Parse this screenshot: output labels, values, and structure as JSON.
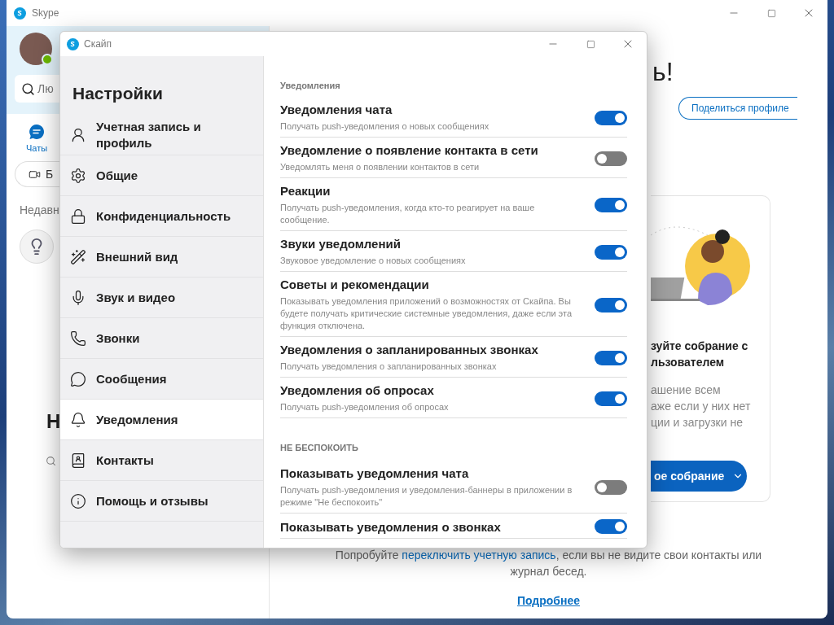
{
  "main_window": {
    "title": "Skype",
    "search": {
      "placeholder": "Лю"
    },
    "nav_tab": {
      "label": "Чаты",
      "selected": true
    },
    "meet_button": "Б",
    "recent_heading": "Недавн",
    "side_heading": "Н",
    "greeting": "ь!",
    "share_button": "Поделиться профиле",
    "card": {
      "title_lines": [
        "зуйте собрание с",
        "льзователем"
      ],
      "text_lines": [
        "ашение всем",
        "аже если у них нет",
        "ции и загрузки не"
      ],
      "button": "ое собрание"
    },
    "footer": {
      "before": "Попробуйте ",
      "link": "переключить учетную запись",
      "after": ", если вы не видите свои контакты или журнал бесед.",
      "more_link": "Подробнее"
    }
  },
  "settings_dialog": {
    "title": "Скайп",
    "heading": "Настройки",
    "menu": [
      {
        "label": "Учетная запись и профиль",
        "selected": false
      },
      {
        "label": "Общие",
        "selected": false
      },
      {
        "label": "Конфиденциальность",
        "selected": false
      },
      {
        "label": "Внешний вид",
        "selected": false
      },
      {
        "label": "Звук и видео",
        "selected": false
      },
      {
        "label": "Звонки",
        "selected": false
      },
      {
        "label": "Сообщения",
        "selected": false
      },
      {
        "label": "Уведомления",
        "selected": true
      },
      {
        "label": "Контакты",
        "selected": false
      },
      {
        "label": "Помощь и отзывы",
        "selected": false
      }
    ],
    "sections": [
      {
        "title": "Уведомления",
        "rows": [
          {
            "title": "Уведомления чата",
            "description": "Получать push-уведомления о новых сообщениях",
            "on": true
          },
          {
            "title": "Уведомление о появление контакта в сети",
            "description": "Уведомлять меня о появлении контактов в сети",
            "on": false
          },
          {
            "title": "Реакции",
            "description": "Получать push-уведомления, когда кто-то реагирует на ваше сообщение.",
            "on": true
          },
          {
            "title": "Звуки уведомлений",
            "description": "Звуковое уведомление о новых сообщениях",
            "on": true
          },
          {
            "title": "Советы и рекомендации",
            "description": "Показывать уведомления приложений о возможностях от Скайпа. Вы будете получать критические системные уведомления, даже если эта функция отключена.",
            "on": true
          },
          {
            "title": "Уведомления о запланированных звонках",
            "description": "Получать уведомления о запланированных звонках",
            "on": true
          },
          {
            "title": "Уведомления об опросах",
            "description": "Получать push-уведомления об опросах",
            "on": true
          }
        ]
      },
      {
        "title": "НЕ БЕСПОКОИТЬ",
        "rows": [
          {
            "title": "Показывать уведомления чата",
            "description": "Получать push-уведомления и уведомления-баннеры в приложении в режиме \"Не беспокоить\"",
            "on": false
          },
          {
            "title": "Показывать уведомления о звонках",
            "on": true
          }
        ]
      }
    ]
  }
}
